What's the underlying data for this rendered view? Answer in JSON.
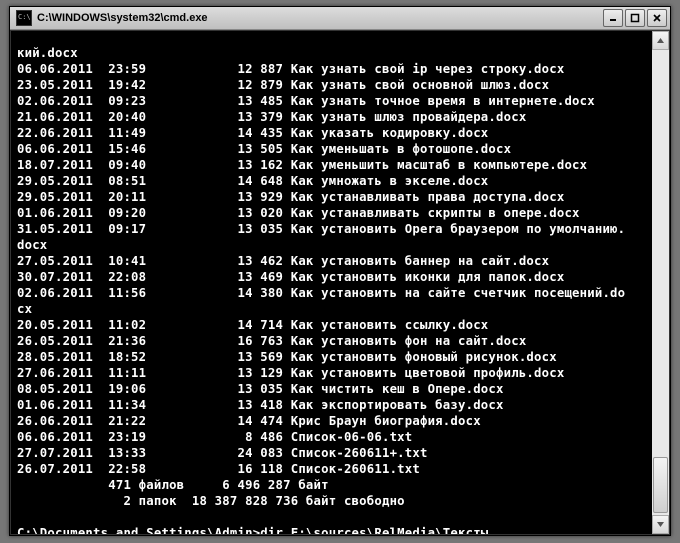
{
  "window": {
    "title": "C:\\WINDOWS\\system32\\cmd.exe"
  },
  "partial_top": "кий.docx",
  "rows": [
    {
      "date": "06.06.2011",
      "time": "23:59",
      "size": "12 887",
      "name": "Как узнать свой ip через строку.docx"
    },
    {
      "date": "23.05.2011",
      "time": "19:42",
      "size": "12 879",
      "name": "Как узнать свой основной шлюз.docx"
    },
    {
      "date": "02.06.2011",
      "time": "09:23",
      "size": "13 485",
      "name": "Как узнать точное время в интернете.docx"
    },
    {
      "date": "21.06.2011",
      "time": "20:40",
      "size": "13 379",
      "name": "Как узнать шлюз провайдера.docx"
    },
    {
      "date": "22.06.2011",
      "time": "11:49",
      "size": "14 435",
      "name": "Как указать кодировку.docx"
    },
    {
      "date": "06.06.2011",
      "time": "15:46",
      "size": "13 505",
      "name": "Как уменьшать в фотошопе.docx"
    },
    {
      "date": "18.07.2011",
      "time": "09:40",
      "size": "13 162",
      "name": "Как уменьшить масштаб в компьютере.docx"
    },
    {
      "date": "29.05.2011",
      "time": "08:51",
      "size": "14 648",
      "name": "Как умножать в экселе.docx"
    },
    {
      "date": "29.05.2011",
      "time": "20:11",
      "size": "13 929",
      "name": "Как устанавливать права доступа.docx"
    },
    {
      "date": "01.06.2011",
      "time": "09:20",
      "size": "13 020",
      "name": "Как устанавливать скрипты в опере.docx"
    }
  ],
  "wrapped": {
    "date": "31.05.2011",
    "time": "09:17",
    "size": "13 035",
    "name_part1": "Как установить Opera браузером по умолчанию.",
    "name_part2": "docx"
  },
  "rows2": [
    {
      "date": "27.05.2011",
      "time": "10:41",
      "size": "13 462",
      "name": "Как установить баннер на сайт.docx"
    },
    {
      "date": "30.07.2011",
      "time": "22:08",
      "size": "13 469",
      "name": "Как установить иконки для папок.docx"
    }
  ],
  "wrapped2": {
    "date": "02.06.2011",
    "time": "11:56",
    "size": "14 380",
    "name_part1": "Как установить на сайте счетчик посещений.do",
    "name_part2": "cx"
  },
  "rows3": [
    {
      "date": "20.05.2011",
      "time": "11:02",
      "size": "14 714",
      "name": "Как установить ссылку.docx"
    },
    {
      "date": "26.05.2011",
      "time": "21:36",
      "size": "16 763",
      "name": "Как установить фон на сайт.docx"
    },
    {
      "date": "28.05.2011",
      "time": "18:52",
      "size": "13 569",
      "name": "Как установить фоновый рисунок.docx"
    },
    {
      "date": "27.06.2011",
      "time": "11:11",
      "size": "13 129",
      "name": "Как установить цветовой профиль.docx"
    },
    {
      "date": "08.05.2011",
      "time": "19:06",
      "size": "13 035",
      "name": "Как чистить кеш в Опере.docx"
    },
    {
      "date": "01.06.2011",
      "time": "11:34",
      "size": "13 418",
      "name": "Как экспортировать базу.docx"
    },
    {
      "date": "26.06.2011",
      "time": "21:22",
      "size": "14 474",
      "name": "Крис Браун биография.docx"
    },
    {
      "date": "06.06.2011",
      "time": "23:19",
      "size": "8 486",
      "name": "Список-06-06.txt"
    },
    {
      "date": "27.07.2011",
      "time": "13:33",
      "size": "24 083",
      "name": "Список-260611+.txt"
    },
    {
      "date": "26.07.2011",
      "time": "22:58",
      "size": "16 118",
      "name": "Список-260611.txt"
    }
  ],
  "summary": {
    "files_count": "471",
    "files_label": "файлов",
    "files_bytes": "6 496 287",
    "bytes_label": "байт",
    "dirs_count": "2",
    "dirs_label": "папок",
    "free_bytes": "18 387 828 736",
    "free_label": "байт свободно"
  },
  "prompt": {
    "path": "C:\\Documents and Settings\\Admin>",
    "command": "dir F:\\sources\\RelMedia\\Тексты"
  }
}
